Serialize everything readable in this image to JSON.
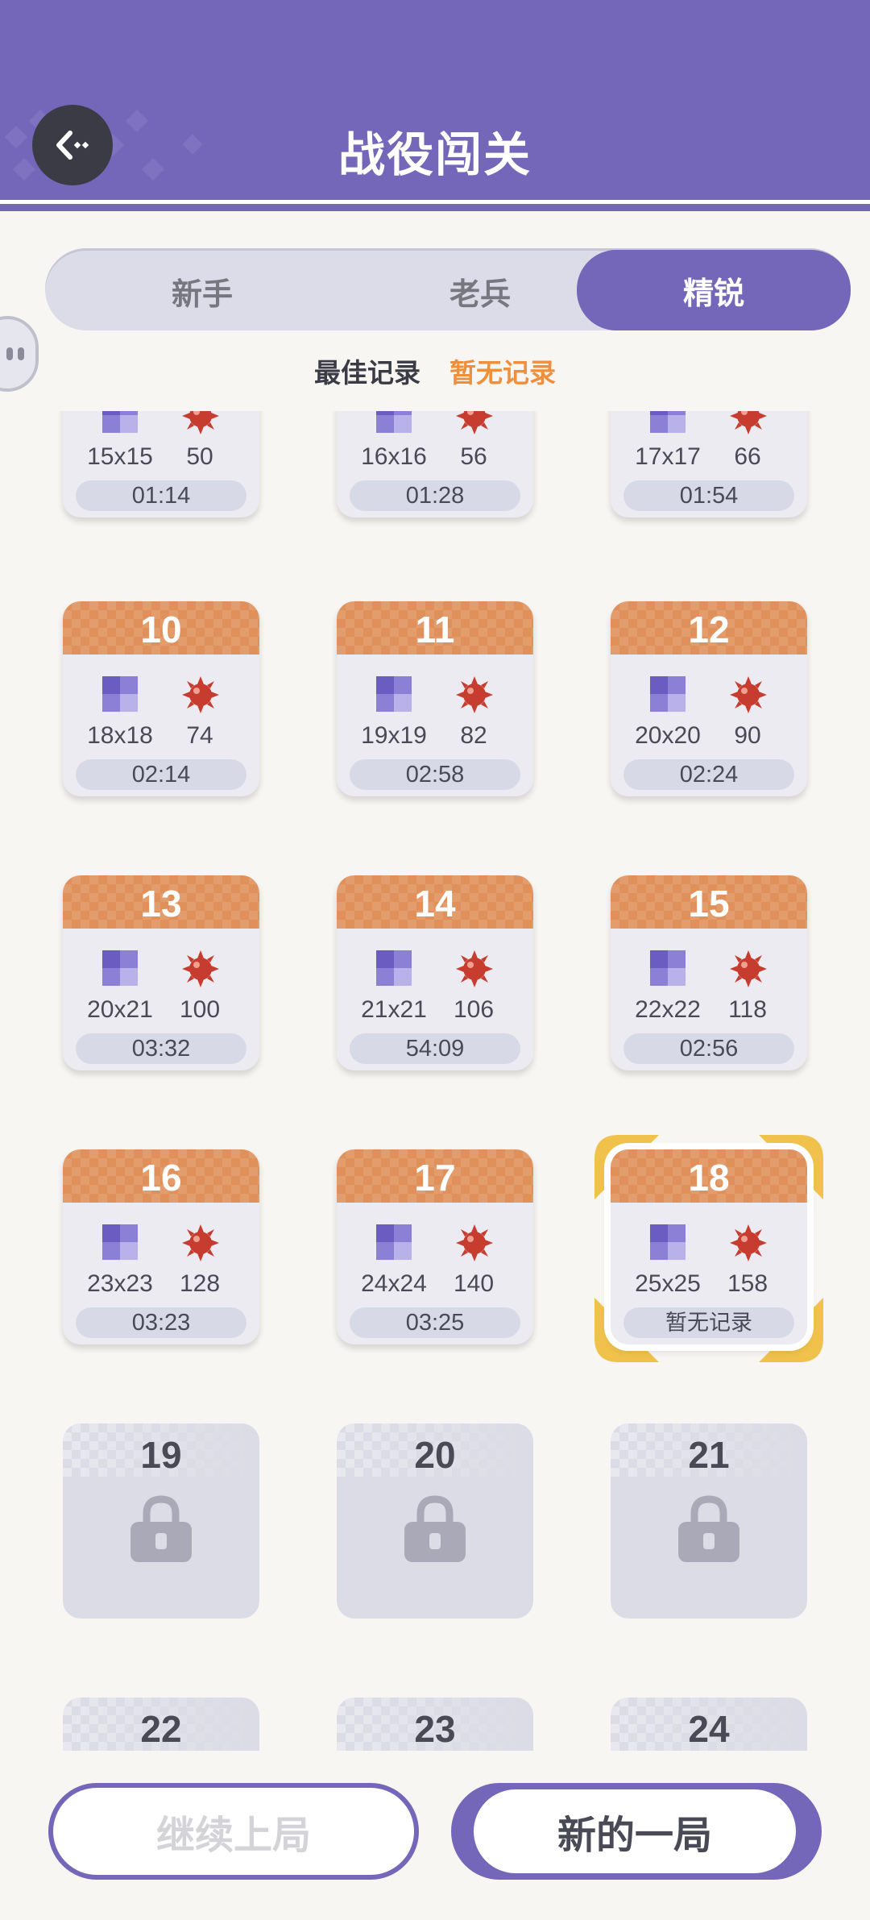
{
  "header": {
    "title": "战役闯关"
  },
  "tabs": [
    {
      "label": "新手",
      "active": false
    },
    {
      "label": "老兵",
      "active": false
    },
    {
      "label": "精锐",
      "active": true
    }
  ],
  "record": {
    "label": "最佳记录",
    "value": "暂无记录"
  },
  "levels": [
    {
      "num": "",
      "size": "15x15",
      "mines": "50",
      "time": "01:14"
    },
    {
      "num": "",
      "size": "16x16",
      "mines": "56",
      "time": "01:28"
    },
    {
      "num": "",
      "size": "17x17",
      "mines": "66",
      "time": "01:54"
    },
    {
      "num": "10",
      "size": "18x18",
      "mines": "74",
      "time": "02:14"
    },
    {
      "num": "11",
      "size": "19x19",
      "mines": "82",
      "time": "02:58"
    },
    {
      "num": "12",
      "size": "20x20",
      "mines": "90",
      "time": "02:24"
    },
    {
      "num": "13",
      "size": "20x21",
      "mines": "100",
      "time": "03:32"
    },
    {
      "num": "14",
      "size": "21x21",
      "mines": "106",
      "time": "54:09"
    },
    {
      "num": "15",
      "size": "22x22",
      "mines": "118",
      "time": "02:56"
    },
    {
      "num": "16",
      "size": "23x23",
      "mines": "128",
      "time": "03:23"
    },
    {
      "num": "17",
      "size": "24x24",
      "mines": "140",
      "time": "03:25"
    },
    {
      "num": "18",
      "size": "25x25",
      "mines": "158",
      "time": "暂无记录",
      "selected": true
    }
  ],
  "locked_levels": [
    "19",
    "20",
    "21",
    "22",
    "23",
    "24"
  ],
  "buttons": {
    "continue": "继续上局",
    "new_game": "新的一局"
  },
  "colors": {
    "brand_purple": "#7466b8",
    "level_orange": "#e0915b",
    "record_orange": "#ee8f3d",
    "selected_gold": "#f0c24b"
  },
  "icons": {
    "back": "back-arrow-icon",
    "board": "board-grid-icon",
    "mine": "mine-icon",
    "lock": "lock-icon"
  }
}
